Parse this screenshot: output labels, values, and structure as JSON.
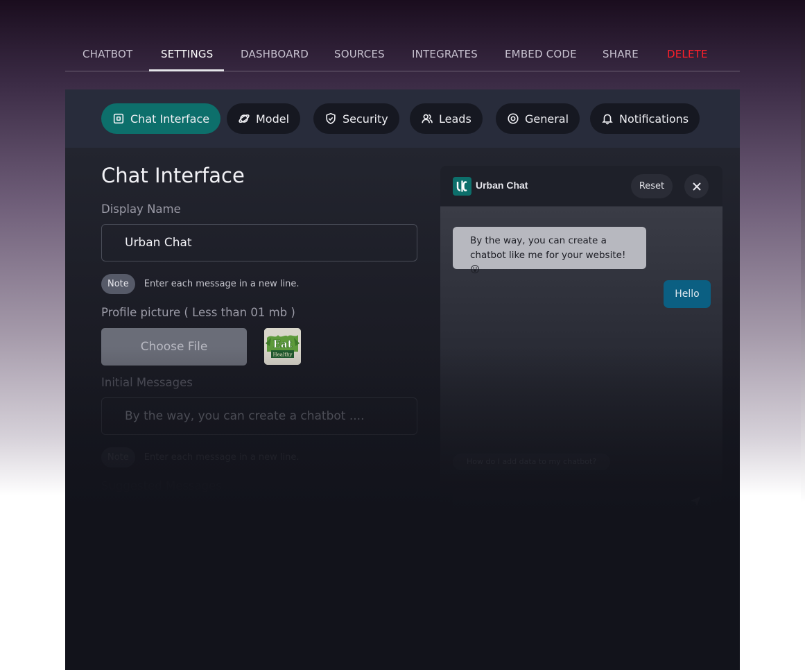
{
  "topnav": {
    "items": [
      "CHATBOT",
      "SETTINGS",
      "DASHBOARD",
      "SOURCES",
      "INTEGRATES",
      "EMBED CODE",
      "SHARE",
      "DELETE"
    ],
    "active": "SETTINGS"
  },
  "subtabs": [
    {
      "label": "Chat Interface",
      "icon": "square-icon"
    },
    {
      "label": "Model",
      "icon": "planet-icon"
    },
    {
      "label": "Security",
      "icon": "shield-check-icon"
    },
    {
      "label": "Leads",
      "icon": "users-icon"
    },
    {
      "label": "General",
      "icon": "target-icon"
    },
    {
      "label": "Notifications",
      "icon": "bell-icon"
    }
  ],
  "form": {
    "title": "Chat Interface",
    "display_name_label": "Display Name",
    "display_name_value": "Urban Chat",
    "note_pill": "Note",
    "note_text": "Enter each message in a new line.",
    "profile_label": "Profile picture ( Less than 01 mb )",
    "choose_file": "Choose File",
    "profile_image_text_1": "Eat",
    "profile_image_text_2": "Healthy",
    "initial_label": "Initial Messages",
    "initial_placeholder": "By the way, you can create a chatbot ....",
    "suggested_label": "Suggested Messages"
  },
  "chat": {
    "name": "Urban Chat",
    "reset": "Reset",
    "bot_message": "By the way, you can create a chatbot like me for your website! 😮",
    "user_message": "Hello",
    "suggestion": "How do I add data to my chatbot?"
  },
  "colors": {
    "accent": "#0d6f6b",
    "user_bubble": "#0b5f82",
    "delete": "#ff1f2a"
  }
}
